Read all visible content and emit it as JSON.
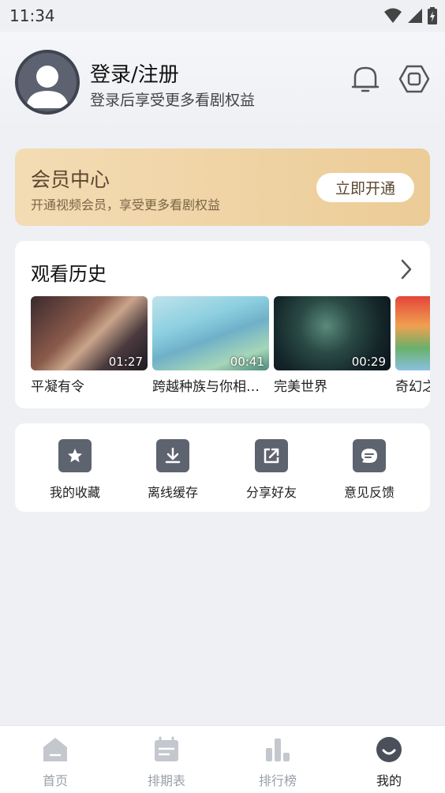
{
  "status_bar": {
    "time": "11:34",
    "icons": [
      "wifi-icon",
      "signal-icon",
      "battery-icon"
    ]
  },
  "header": {
    "title": "登录/注册",
    "subtitle": "登录后享受更多看剧权益",
    "icons": [
      "bell-icon",
      "settings-icon"
    ]
  },
  "vip": {
    "title": "会员中心",
    "subtitle": "开通视频会员，享受更多看剧权益",
    "button": "立即开通"
  },
  "history": {
    "title": "观看历史",
    "items": [
      {
        "title": "平凝有令",
        "duration": "01:27"
      },
      {
        "title": "跨越种族与你相…",
        "duration": "00:41"
      },
      {
        "title": "完美世界",
        "duration": "00:29"
      },
      {
        "title": "奇幻之",
        "duration": ""
      }
    ]
  },
  "tools": [
    {
      "label": "我的收藏",
      "icon": "star-icon"
    },
    {
      "label": "离线缓存",
      "icon": "download-icon"
    },
    {
      "label": "分享好友",
      "icon": "share-icon"
    },
    {
      "label": "意见反馈",
      "icon": "feedback-icon"
    }
  ],
  "tabbar": [
    {
      "label": "首页",
      "icon": "home-icon",
      "active": false
    },
    {
      "label": "排期表",
      "icon": "calendar-icon",
      "active": false
    },
    {
      "label": "排行榜",
      "icon": "ranking-icon",
      "active": false
    },
    {
      "label": "我的",
      "icon": "profile-icon",
      "active": true
    }
  ],
  "colors": {
    "vip_gradient_start": "#f3dcb4",
    "vip_gradient_end": "#eccc97",
    "icon_gray": "#5e6370",
    "tab_inactive": "#9aa0a8",
    "tab_active": "#222222"
  }
}
